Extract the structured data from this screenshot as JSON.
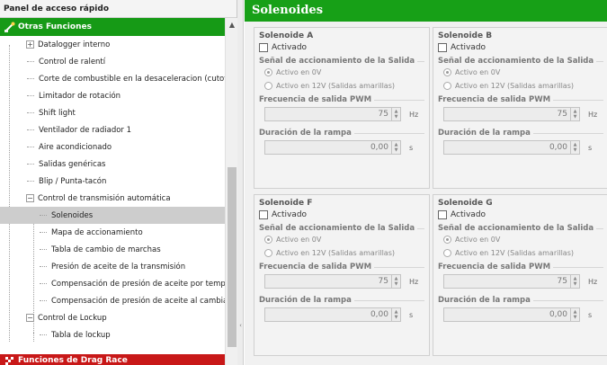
{
  "quick_panel": {
    "title": "Panel de acceso rápido",
    "group_label": "Otras Funciones",
    "bottom_group_label": "Funciones de Drag Race",
    "items": [
      {
        "label": "Datalogger interno"
      },
      {
        "label": "Control de ralentí"
      },
      {
        "label": "Corte de combustible en la desaceleracion (cutoff)"
      },
      {
        "label": "Limitador de rotación"
      },
      {
        "label": "Shift light"
      },
      {
        "label": "Ventilador de radiador 1"
      },
      {
        "label": "Aire acondicionado"
      },
      {
        "label": "Salidas genéricas"
      },
      {
        "label": "Blip / Punta-tacón"
      },
      {
        "label": "Control de transmisión automática"
      },
      {
        "label": "Solenoides"
      },
      {
        "label": "Mapa de accionamiento"
      },
      {
        "label": "Tabla de cambio de marchas"
      },
      {
        "label": "Presión de aceite de la transmisión"
      },
      {
        "label": "Compensación de presión de aceite por temperatura"
      },
      {
        "label": "Compensación de presión de aceite al cambiar marcha"
      },
      {
        "label": "Control de Lockup"
      },
      {
        "label": "Tabla de lockup"
      }
    ],
    "expander_plus": "+",
    "expander_minus": "−"
  },
  "solenoids": {
    "title": "Solenoides",
    "cards": [
      {
        "title": "Solenoide A"
      },
      {
        "title": "Solenoide B"
      },
      {
        "title": "Solenoide F"
      },
      {
        "title": "Solenoide G"
      }
    ],
    "activated_label": "Activado",
    "signal_group_label": "Señal de accionamiento de la Salida",
    "option_0v": "Activo en 0V",
    "option_12v": "Activo en 12V (Salidas amarillas)",
    "freq_label": "Frecuencia de salida PWM",
    "freq_value": "75",
    "freq_unit": "Hz",
    "ramp_label": "Duración de la rampa",
    "ramp_value": "0,00",
    "ramp_unit": "s"
  },
  "colors": {
    "accent_green": "#17a017",
    "accent_red": "#c81818",
    "selected_row": "#cdcdcd"
  }
}
